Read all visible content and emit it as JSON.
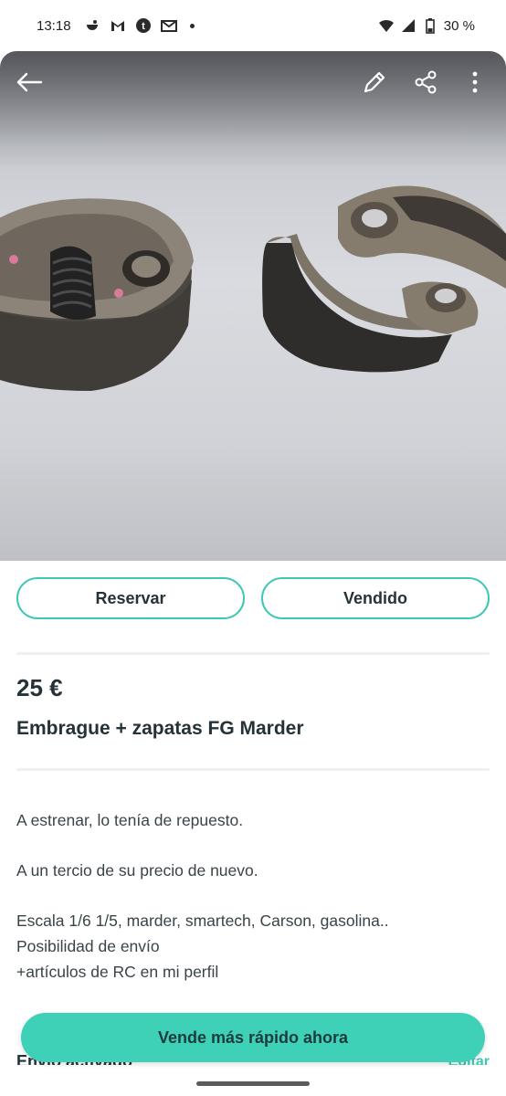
{
  "status_bar": {
    "time": "13:18",
    "battery": "30 %",
    "icons": [
      "notification-app-icon",
      "gmail-icon",
      "tumblr-icon",
      "mail-app-icon",
      "wifi-icon",
      "signal-icon",
      "battery-icon"
    ]
  },
  "toolbar": {
    "back_icon": "arrow-left-icon",
    "edit_icon": "pencil-icon",
    "share_icon": "share-icon",
    "more_icon": "more-vertical-icon"
  },
  "actions": {
    "reserve_label": "Reservar",
    "sold_label": "Vendido"
  },
  "listing": {
    "price": "25 €",
    "title": "Embrague + zapatas FG Marder",
    "description": [
      "A estrenar, lo tenía de repuesto.",
      "A un tercio de su precio de nuevo.",
      "Escala 1/6 1/5, marder, smartech, Carson, gasolina..\nPosibilidad de envío\n+artículos de RC en mi perfil"
    ]
  },
  "shipping": {
    "label": "Envío activado",
    "edit_label": "Editar"
  },
  "cta": {
    "label": "Vende más rápido ahora"
  },
  "colors": {
    "accent": "#3cc8b4",
    "cta_bg": "#3fd0b8",
    "text": "#253238"
  }
}
